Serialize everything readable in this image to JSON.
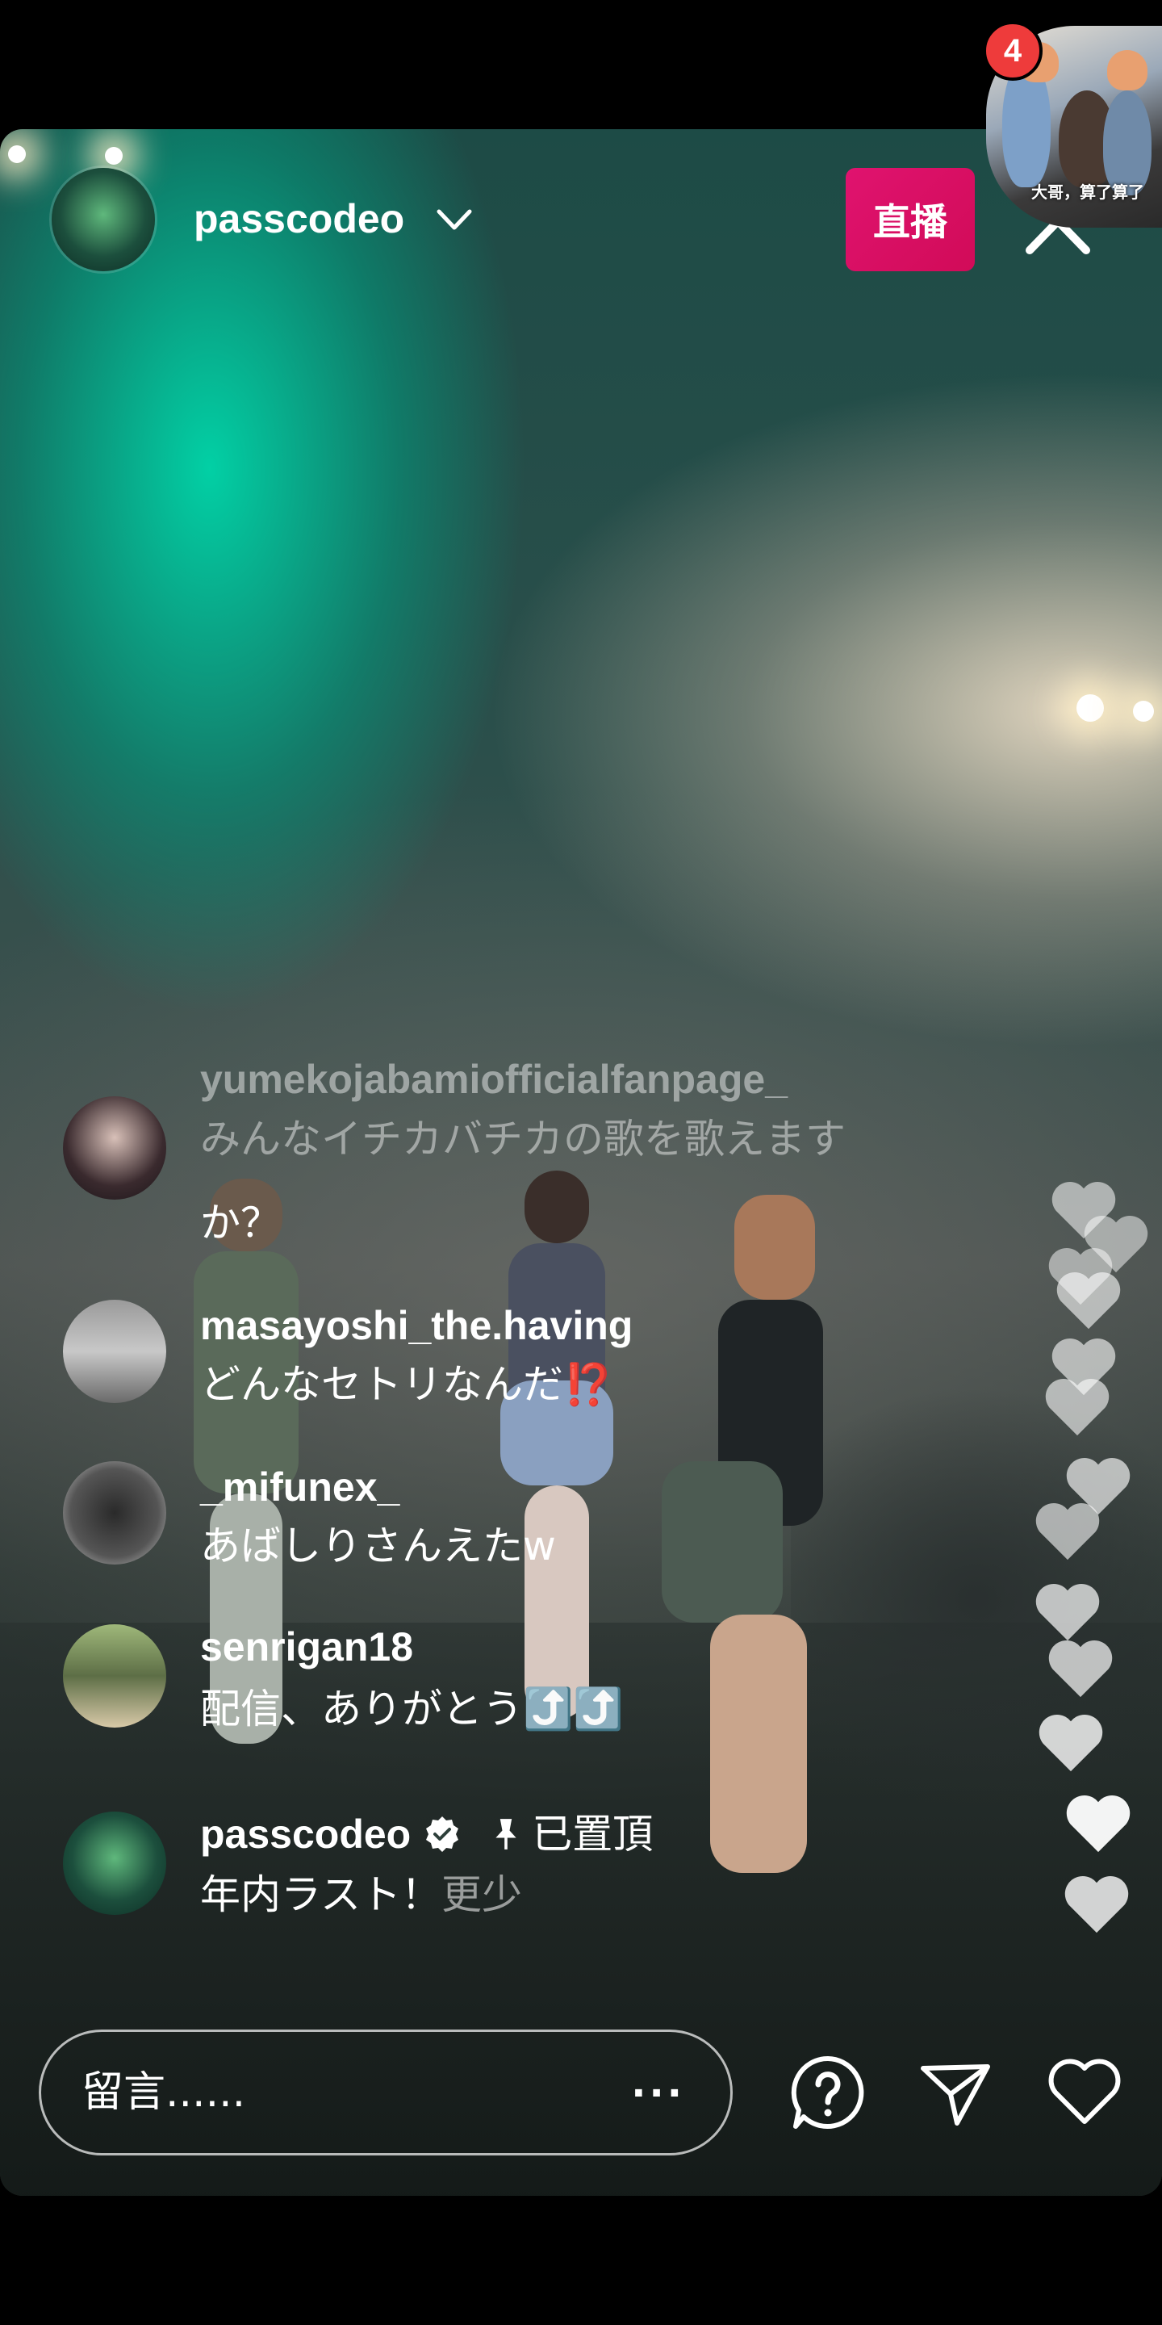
{
  "pip": {
    "caption": "大哥，算了算了",
    "badge_count": "4"
  },
  "header": {
    "username": "passcodeo",
    "live_label": "直播"
  },
  "comments": [
    {
      "username": "yumekojabamiofficialfanpage_",
      "text": "みんなイチカバチカの歌を歌えます",
      "text_cont": "か？"
    },
    {
      "username": "masayoshi_the.having",
      "text": "どんなセトリなんだ⁉️"
    },
    {
      "username": "_mifunex_",
      "text": "あばしりさんえたw"
    },
    {
      "username": "senrigan18",
      "text": "配信、ありがとう⤴️⤴️"
    },
    {
      "username": "passcodeo",
      "pinned_label": "已置頂",
      "text": "年内ラスト！",
      "more_label": "更少"
    }
  ],
  "composer": {
    "placeholder": "留言......",
    "more": "···"
  },
  "icons": {
    "collapse": "chevron-up-icon",
    "verified": "verified-badge-icon",
    "pin": "pin-icon",
    "question": "question-icon",
    "share": "paper-plane-icon",
    "like": "heart-icon",
    "floating_hearts": "heart-icon"
  },
  "colors": {
    "live_button": "#d10b58",
    "badge": "#ee3b3b"
  }
}
